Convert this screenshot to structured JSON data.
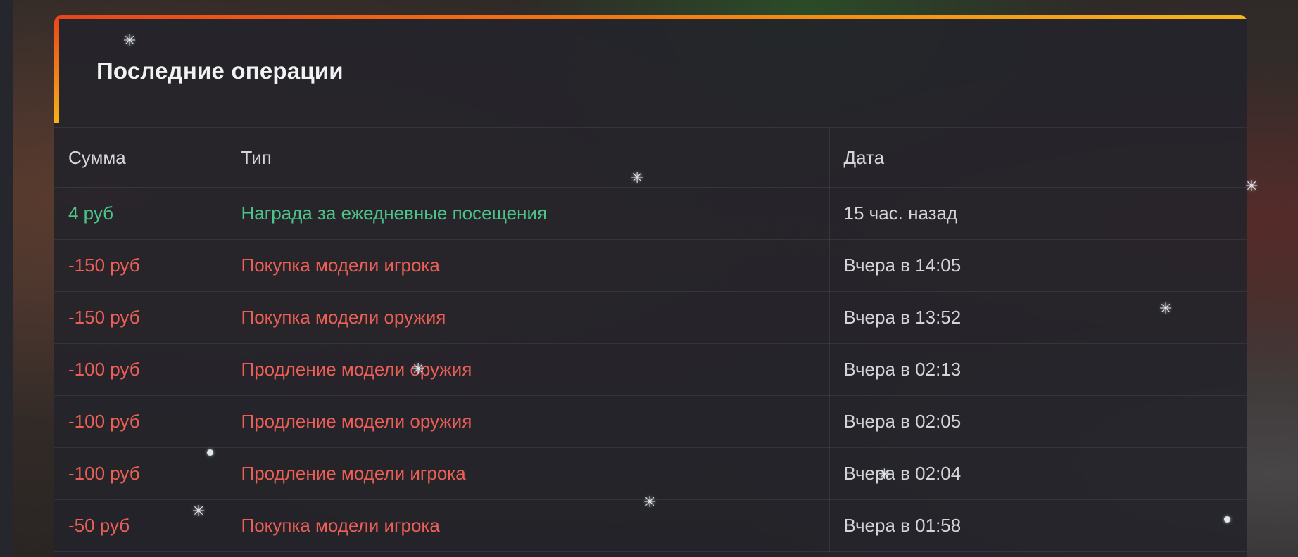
{
  "panel": {
    "title": "Последние операции",
    "accent_gradient": [
      "#e8451c",
      "#f5b51a"
    ]
  },
  "table": {
    "columns": [
      "Сумма",
      "Тип",
      "Дата"
    ],
    "rows": [
      {
        "amount": "4 руб",
        "type": "Награда за ежедневные посещения",
        "date": "15 час. назад",
        "status": "credit"
      },
      {
        "amount": "-150 руб",
        "type": "Покупка модели игрока",
        "date": "Вчера в 14:05",
        "status": "debit"
      },
      {
        "amount": "-150 руб",
        "type": "Покупка модели оружия",
        "date": "Вчера в 13:52",
        "status": "debit"
      },
      {
        "amount": "-100 руб",
        "type": "Продление модели оружия",
        "date": "Вчера в 02:13",
        "status": "debit"
      },
      {
        "amount": "-100 руб",
        "type": "Продление модели оружия",
        "date": "Вчера в 02:05",
        "status": "debit"
      },
      {
        "amount": "-100 руб",
        "type": "Продление модели игрока",
        "date": "Вчера в 02:04",
        "status": "debit"
      },
      {
        "amount": "-50 руб",
        "type": "Покупка модели игрока",
        "date": "Вчера в 01:58",
        "status": "debit"
      }
    ]
  },
  "colors": {
    "credit": "#4cc38a",
    "debit": "#ec5f56",
    "text": "#d4d4d7"
  },
  "decorations": {
    "snowflake_icon": "snowflake-icon"
  }
}
